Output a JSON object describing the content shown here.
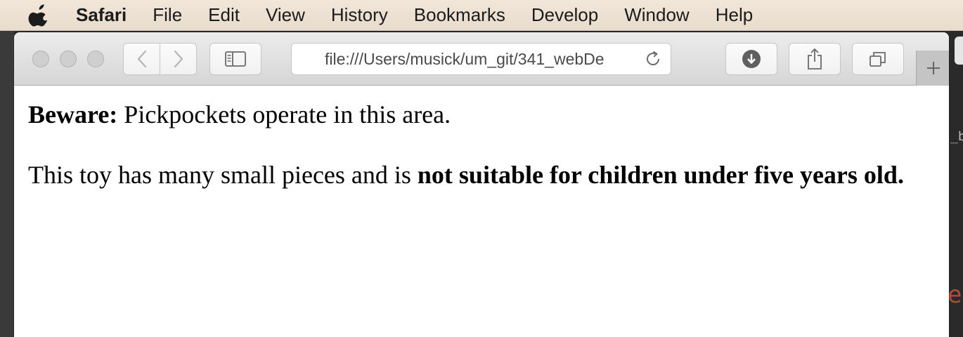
{
  "menubar": {
    "apple_icon": "apple-logo-icon",
    "app_name": "Safari",
    "items": [
      "File",
      "Edit",
      "View",
      "History",
      "Bookmarks",
      "Develop",
      "Window",
      "Help"
    ]
  },
  "toolbar": {
    "icons": {
      "back": "chevron-left-icon",
      "forward": "chevron-right-icon",
      "sidebar": "sidebar-icon",
      "reload": "reload-icon",
      "download": "download-icon",
      "share": "share-icon",
      "tabs": "tab-overview-icon",
      "new_tab": "plus-icon"
    },
    "address_url": "file:///Users/musick/um_git/341_webDe"
  },
  "background": {
    "right_text_1": "_b",
    "right_text_2": "e:"
  },
  "page": {
    "p1": {
      "bold": "Beware:",
      "normal": " Pickpockets operate in this area."
    },
    "p2": {
      "normal": "This toy has many small pieces and is ",
      "bold": "not suitable for children under five years old."
    }
  },
  "colors": {
    "menubar_bg": "#efe3d6",
    "toolbar_bg": "#e2e2e2",
    "page_bg": "#ffffff",
    "text": "#000000"
  }
}
